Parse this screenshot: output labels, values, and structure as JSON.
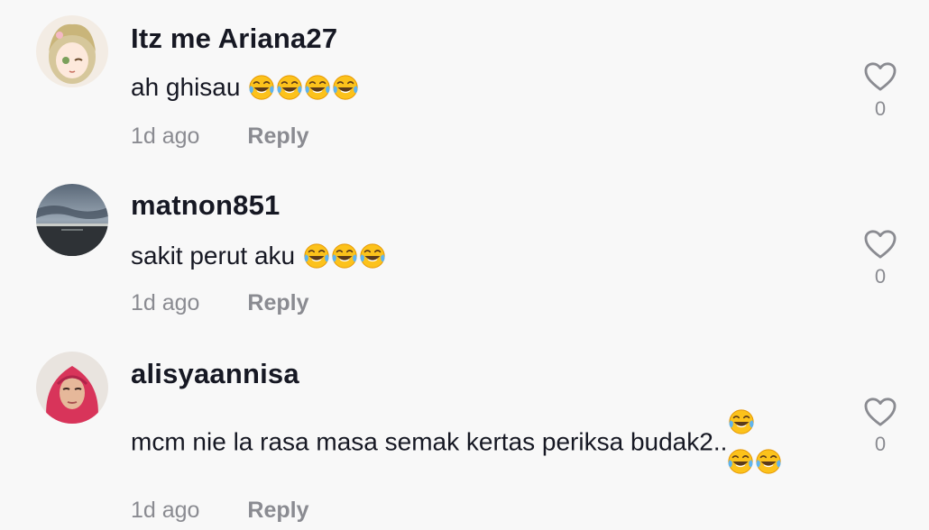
{
  "comments": [
    {
      "username": "Itz me Ariana27",
      "text": "ah ghisau",
      "emoji_count": 4,
      "time": "1d ago",
      "reply_label": "Reply",
      "like_count": "0"
    },
    {
      "username": "matnon851",
      "text": "sakit perut aku",
      "emoji_count": 3,
      "time": "1d ago",
      "reply_label": "Reply",
      "like_count": "0"
    },
    {
      "username": "alisyaannisa",
      "text": "mcm nie la rasa masa semak kertas periksa budak2..",
      "emoji_count": 3,
      "time": "1d ago",
      "reply_label": "Reply",
      "like_count": "0"
    }
  ],
  "icons": {
    "like": "heart-outline-icon",
    "emoji": "face-with-tears-of-joy-icon"
  },
  "colors": {
    "background": "#f8f8f8",
    "primary_text": "#161823",
    "secondary_text": "#8a8b91"
  }
}
